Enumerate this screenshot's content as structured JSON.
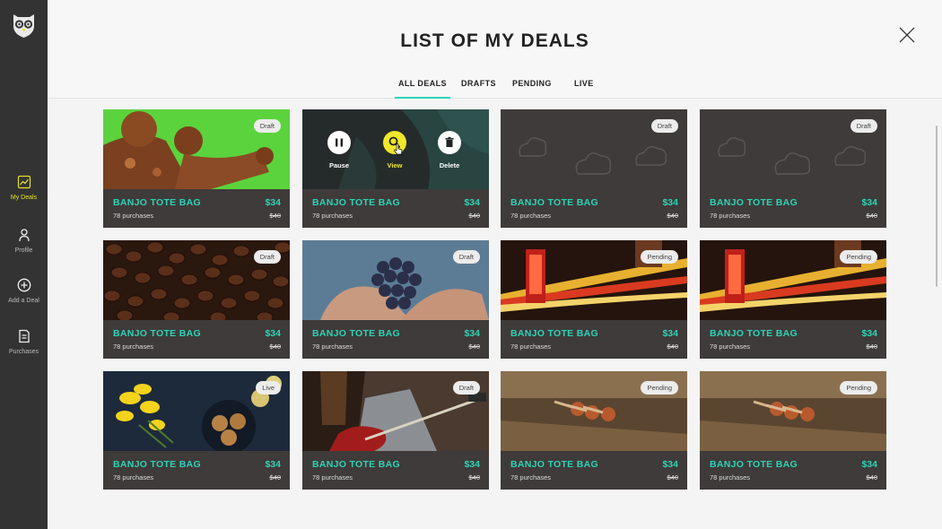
{
  "sidebar": {
    "items": [
      {
        "label": "My Deals",
        "icon": "chart-icon",
        "active": true
      },
      {
        "label": "Profile",
        "icon": "person-icon",
        "active": false
      },
      {
        "label": "Add a Deal",
        "icon": "plus-circle-icon",
        "active": false
      },
      {
        "label": "Purchases",
        "icon": "document-icon",
        "active": false
      }
    ]
  },
  "header": {
    "title": "LIST OF MY DEALS",
    "tabs": [
      {
        "label": "ALL DEALS",
        "active": true
      },
      {
        "label": "DRAFTS",
        "active": false
      },
      {
        "label": "PENDING",
        "active": false
      },
      {
        "label": "LIVE",
        "active": false
      }
    ]
  },
  "actions": {
    "pause": "Pause",
    "view": "View",
    "delete": "Delete"
  },
  "colors": {
    "accent": "#2ed3b7",
    "highlight": "#f0e82b",
    "sidebar": "#333333",
    "card": "#3e3b3a"
  },
  "deals": [
    {
      "name": "BANJO TOTE BAG",
      "purchases": "78 purchases",
      "price": "$34",
      "old_price": "$40",
      "status": "Draft",
      "image": "rusty-crown"
    },
    {
      "name": "BANJO TOTE BAG",
      "purchases": "78 purchases",
      "price": "$34",
      "old_price": "$40",
      "status": "",
      "image": "teal-abstract"
    },
    {
      "name": "BANJO TOTE BAG",
      "purchases": "78 purchases",
      "price": "$34",
      "old_price": "$40",
      "status": "Draft",
      "image": "cloud-placeholder"
    },
    {
      "name": "BANJO TOTE BAG",
      "purchases": "78 purchases",
      "price": "$34",
      "old_price": "$40",
      "status": "Draft",
      "image": "cloud-placeholder"
    },
    {
      "name": "BANJO TOTE BAG",
      "purchases": "78 purchases",
      "price": "$34",
      "old_price": "$40",
      "status": "Draft",
      "image": "coffee-beans"
    },
    {
      "name": "BANJO TOTE BAG",
      "purchases": "78 purchases",
      "price": "$34",
      "old_price": "$40",
      "status": "Draft",
      "image": "grapes-hands"
    },
    {
      "name": "BANJO TOTE BAG",
      "purchases": "78 purchases",
      "price": "$34",
      "old_price": "$40",
      "status": "Pending",
      "image": "london-night"
    },
    {
      "name": "BANJO TOTE BAG",
      "purchases": "78 purchases",
      "price": "$34",
      "old_price": "$40",
      "status": "Pending",
      "image": "london-night"
    },
    {
      "name": "BANJO TOTE BAG",
      "purchases": "78 purchases",
      "price": "$34",
      "old_price": "$40",
      "status": "Live",
      "image": "flowers-cookies"
    },
    {
      "name": "BANJO TOTE BAG",
      "purchases": "78 purchases",
      "price": "$34",
      "old_price": "$40",
      "status": "Draft",
      "image": "guitarist"
    },
    {
      "name": "BANJO TOTE BAG",
      "purchases": "78 purchases",
      "price": "$34",
      "old_price": "$40",
      "status": "Pending",
      "image": "shuttlecocks"
    },
    {
      "name": "BANJO TOTE BAG",
      "purchases": "78 purchases",
      "price": "$34",
      "old_price": "$40",
      "status": "Pending",
      "image": "shuttlecocks"
    }
  ]
}
